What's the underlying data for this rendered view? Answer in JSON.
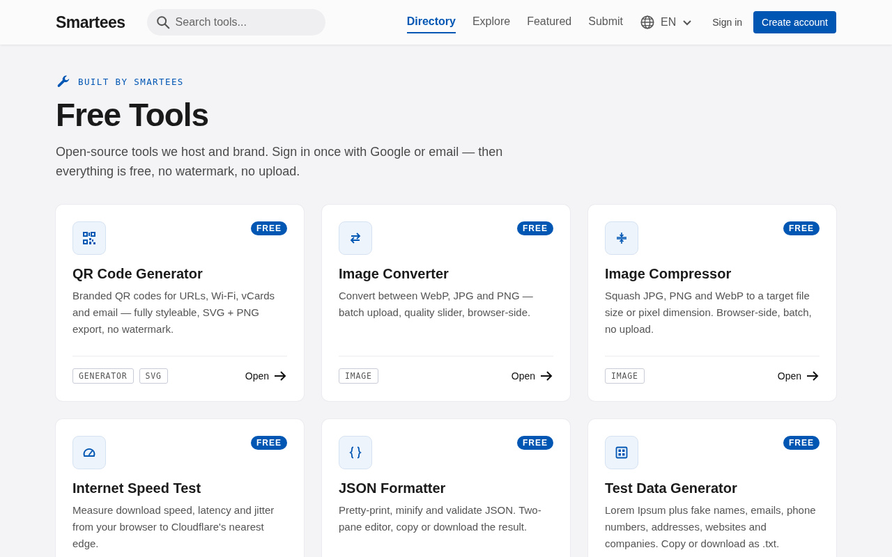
{
  "header": {
    "logo": "Smartees",
    "search": {
      "placeholder": "Search tools..."
    },
    "nav": [
      {
        "label": "Directory",
        "selected": true
      },
      {
        "label": "Explore",
        "selected": false
      },
      {
        "label": "Featured",
        "selected": false
      },
      {
        "label": "Submit",
        "selected": false
      }
    ],
    "language": "EN",
    "sign_in": "Sign in",
    "create_account": "Create account"
  },
  "hero": {
    "eyebrow": "BUILT BY SMARTEES",
    "title": "Free Tools",
    "subtitle": "Open-source tools we host and brand. Sign in once with Google or email — then everything is free, no watermark, no upload."
  },
  "cards": [
    {
      "kind": "qr",
      "badge": "FREE",
      "title": "QR Code Generator",
      "description": "Branded QR codes for URLs, Wi-Fi, vCards and email — fully styleable, SVG + PNG export, no watermark.",
      "tags": [
        "GENERATOR",
        "SVG"
      ],
      "open": "Open"
    },
    {
      "kind": "convert",
      "badge": "FREE",
      "title": "Image Converter",
      "description": "Convert between WebP, JPG and PNG — batch upload, quality slider, browser-side.",
      "tags": [
        "IMAGE"
      ],
      "open": "Open"
    },
    {
      "kind": "compress",
      "badge": "FREE",
      "title": "Image Compressor",
      "description": "Squash JPG, PNG and WebP to a target file size or pixel dimension. Browser-side, batch, no upload.",
      "tags": [
        "IMAGE"
      ],
      "open": "Open"
    },
    {
      "kind": "gauge",
      "badge": "FREE",
      "title": "Internet Speed Test",
      "description": "Measure download speed, latency and jitter from your browser to Cloudflare's nearest edge."
    },
    {
      "kind": "braces",
      "badge": "FREE",
      "title": "JSON Formatter",
      "description": "Pretty-print, minify and validate JSON. Two-pane editor, copy or download the result."
    },
    {
      "kind": "grid",
      "badge": "FREE",
      "title": "Test Data Generator",
      "description": "Lorem Ipsum plus fake names, emails, phone numbers, addresses, websites and companies. Copy or download as .txt."
    }
  ]
}
